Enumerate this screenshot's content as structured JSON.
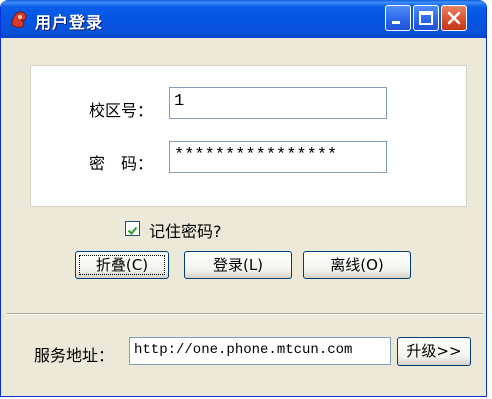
{
  "window": {
    "title": "用户登录",
    "icons": {
      "app": "app-logo-icon",
      "minimize": "minimize-icon",
      "maximize": "maximize-icon",
      "close": "close-icon"
    }
  },
  "form": {
    "campus_label": "校区号：",
    "campus_value": "1",
    "password_label": "密　码：",
    "password_value": "****************",
    "remember_label": "记住密码?",
    "remember_checked": true
  },
  "buttons": {
    "fold": "折叠(C)",
    "login": "登录(L)",
    "offline": "离线(O)"
  },
  "server": {
    "label": "服务地址：",
    "url": "http://one.phone.mtcun.com",
    "upgrade": "升级>>"
  }
}
